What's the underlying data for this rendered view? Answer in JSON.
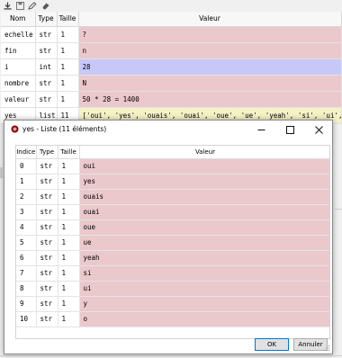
{
  "explorer": {
    "columns": [
      "Nom",
      "Type",
      "Taille",
      "Valeur"
    ],
    "rows": [
      {
        "name": "echelle",
        "type": "str",
        "size": "1",
        "value": "?"
      },
      {
        "name": "fin",
        "type": "str",
        "size": "1",
        "value": "n"
      },
      {
        "name": "i",
        "type": "int",
        "size": "1",
        "value": "28"
      },
      {
        "name": "nombre",
        "type": "str",
        "size": "1",
        "value": "N"
      },
      {
        "name": "valeur",
        "type": "str",
        "size": "1",
        "value": "50 * 28 = 1400"
      },
      {
        "name": "yes",
        "type": "list",
        "size": "11",
        "value": "['oui', 'yes', 'ouais', 'ouai', 'oue', 'ue', 'yeah', 'si', 'ui', 'y', ..."
      }
    ],
    "colors": {
      "str": "#ebc8cc",
      "int": "#c7c8f8",
      "list": "#f5f2c6"
    }
  },
  "dialog": {
    "title": "yes - Liste (11 éléments)",
    "columns": [
      "Indice",
      "Type",
      "Taille",
      "Valeur"
    ],
    "rows": [
      {
        "index": "0",
        "type": "str",
        "size": "1",
        "value": "oui"
      },
      {
        "index": "1",
        "type": "str",
        "size": "1",
        "value": "yes"
      },
      {
        "index": "2",
        "type": "str",
        "size": "1",
        "value": "ouais"
      },
      {
        "index": "3",
        "type": "str",
        "size": "1",
        "value": "ouai"
      },
      {
        "index": "4",
        "type": "str",
        "size": "1",
        "value": "oue"
      },
      {
        "index": "5",
        "type": "str",
        "size": "1",
        "value": "ue"
      },
      {
        "index": "6",
        "type": "str",
        "size": "1",
        "value": "yeah"
      },
      {
        "index": "7",
        "type": "str",
        "size": "1",
        "value": "si"
      },
      {
        "index": "8",
        "type": "str",
        "size": "1",
        "value": "ui"
      },
      {
        "index": "9",
        "type": "str",
        "size": "1",
        "value": "y"
      },
      {
        "index": "10",
        "type": "str",
        "size": "1",
        "value": "o"
      }
    ],
    "ok_label": "OK",
    "cancel_label": "Annuler"
  }
}
